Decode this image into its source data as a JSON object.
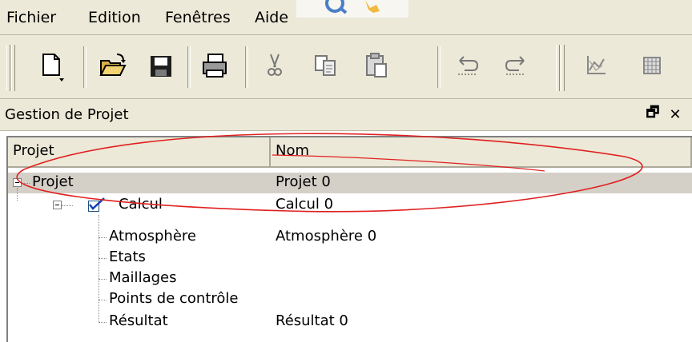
{
  "menu": {
    "items": [
      "Fichier",
      "Edition",
      "Fenêtres",
      "Aide"
    ]
  },
  "toolbar": {
    "icons": [
      "new-document-icon",
      "open-folder-icon",
      "save-icon",
      "print-icon",
      "cut-icon",
      "copy-icon",
      "paste-icon",
      "undo-icon",
      "redo-icon",
      "chart-icon",
      "grid-icon"
    ]
  },
  "panel": {
    "title": "Gestion de Projet",
    "float_glyph": "🗗",
    "close_glyph": "✕"
  },
  "tree": {
    "columns": [
      "Projet",
      "Nom"
    ],
    "rows": [
      {
        "label": "Projet",
        "name": "Projet 0"
      },
      {
        "label": "Calcul",
        "name": "Calcul 0"
      },
      {
        "label": "Atmosphère",
        "name": "Atmosphère 0"
      },
      {
        "label": "Etats",
        "name": ""
      },
      {
        "label": "Maillages",
        "name": ""
      },
      {
        "label": "Points de contrôle",
        "name": ""
      },
      {
        "label": "Résultat",
        "name": "Résultat 0"
      }
    ]
  },
  "colors": {
    "chrome": "#ece9d8",
    "annotation": "#e02020",
    "checkbox_check": "#1a3fb5"
  }
}
